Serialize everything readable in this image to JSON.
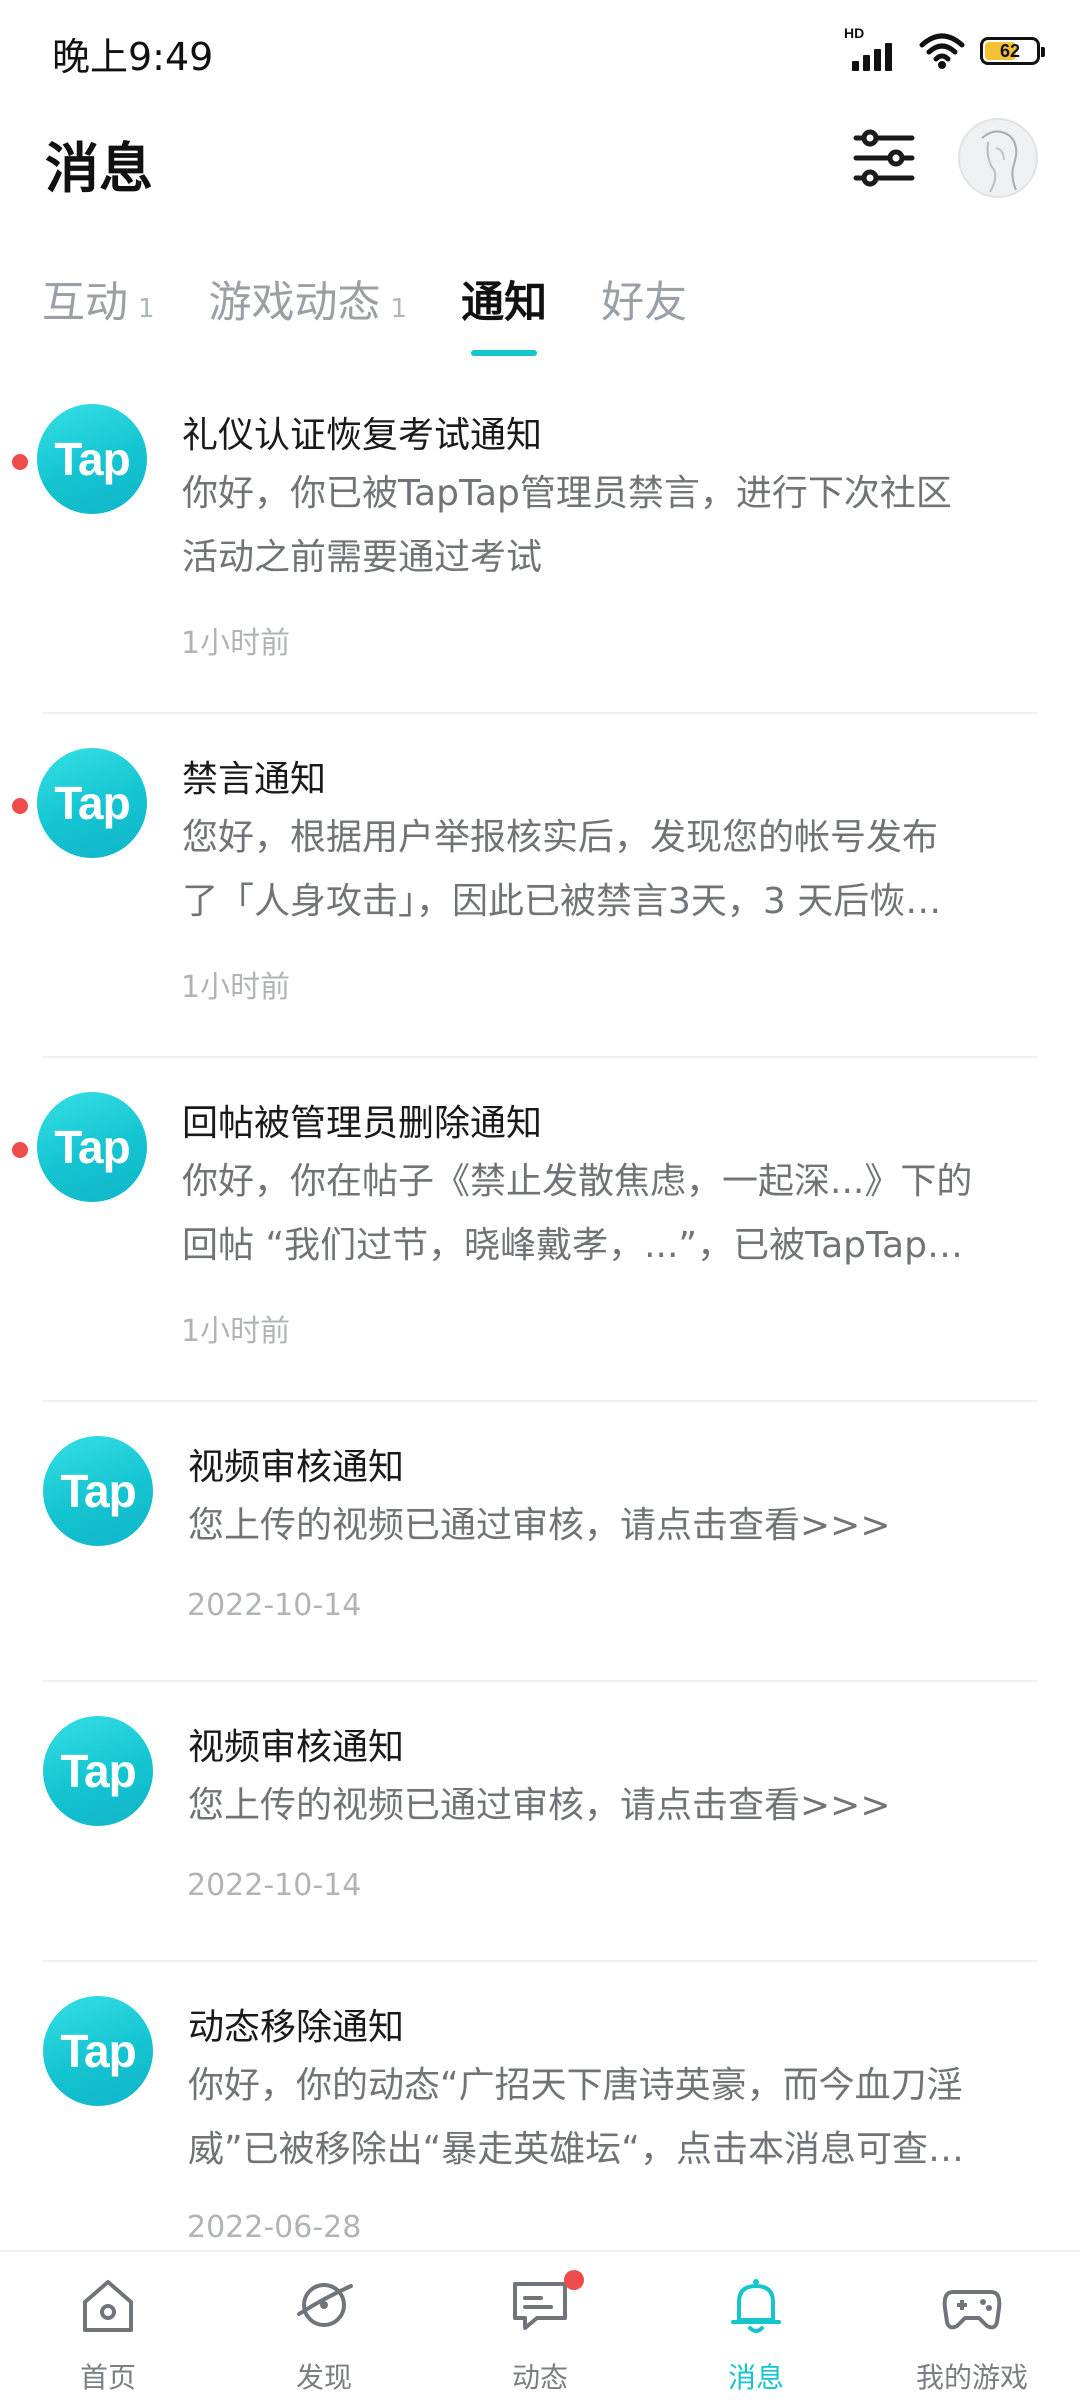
{
  "status_bar": {
    "time": "晚上9:49",
    "network": "HD",
    "battery_percent": "62"
  },
  "header": {
    "title": "消息",
    "filter_icon": "sliders-icon",
    "avatar_icon": "user-avatar"
  },
  "tabs": [
    {
      "label": "互动",
      "count": "1",
      "active": false
    },
    {
      "label": "游戏动态",
      "count": "1",
      "active": false
    },
    {
      "label": "通知",
      "count": "",
      "active": true
    },
    {
      "label": "好友",
      "count": "",
      "active": false
    }
  ],
  "notifications": [
    {
      "logo_text": "Tap",
      "title": "礼仪认证恢复考试通知",
      "body_lines": [
        "你好，你已被TapTap管理员禁言，进行下次社区",
        "活动之前需要通过考试"
      ],
      "time": "1小时前",
      "unread": true
    },
    {
      "logo_text": "Tap",
      "title": "禁言通知",
      "body_lines": [
        "您好，根据用户举报核实后，发现您的帐号发布",
        "了「人身攻击」，因此已被禁言3天，3 天后恢…"
      ],
      "time": "1小时前",
      "unread": true
    },
    {
      "logo_text": "Tap",
      "title": "回帖被管理员删除通知",
      "body_lines": [
        "你好，你在帖子《禁止发散焦虑，一起深...》下的",
        "回帖 “我们过节，晓峰戴孝，...”，已被TapTap…"
      ],
      "time": "1小时前",
      "unread": true
    },
    {
      "logo_text": "Tap",
      "title": "视频审核通知",
      "body_lines": [
        "您上传的视频已通过审核，请点击查看>>>"
      ],
      "time": "2022-10-14",
      "unread": false
    },
    {
      "logo_text": "Tap",
      "title": "视频审核通知",
      "body_lines": [
        "您上传的视频已通过审核，请点击查看>>>"
      ],
      "time": "2022-10-14",
      "unread": false
    },
    {
      "logo_text": "Tap",
      "title": "动态移除通知",
      "body_lines": [
        "你好，你的动态“广招天下唐诗英豪，而今血刀淫",
        "威”已被移除出“暴走英雄坛“，点击本消息可查…"
      ],
      "time": "2022-06-28",
      "unread": false
    }
  ],
  "bottom_nav": [
    {
      "label": "首页",
      "icon": "home-icon",
      "active": false,
      "badge": false
    },
    {
      "label": "发现",
      "icon": "discover-icon",
      "active": false,
      "badge": false
    },
    {
      "label": "动态",
      "icon": "chat-icon",
      "active": false,
      "badge": true
    },
    {
      "label": "消息",
      "icon": "bell-icon",
      "active": true,
      "badge": false
    },
    {
      "label": "我的游戏",
      "icon": "gamepad-icon",
      "active": false,
      "badge": false
    }
  ],
  "colors": {
    "accent": "#15c5ce",
    "unread": "#ee4b4b",
    "battery": "#f2c230"
  }
}
